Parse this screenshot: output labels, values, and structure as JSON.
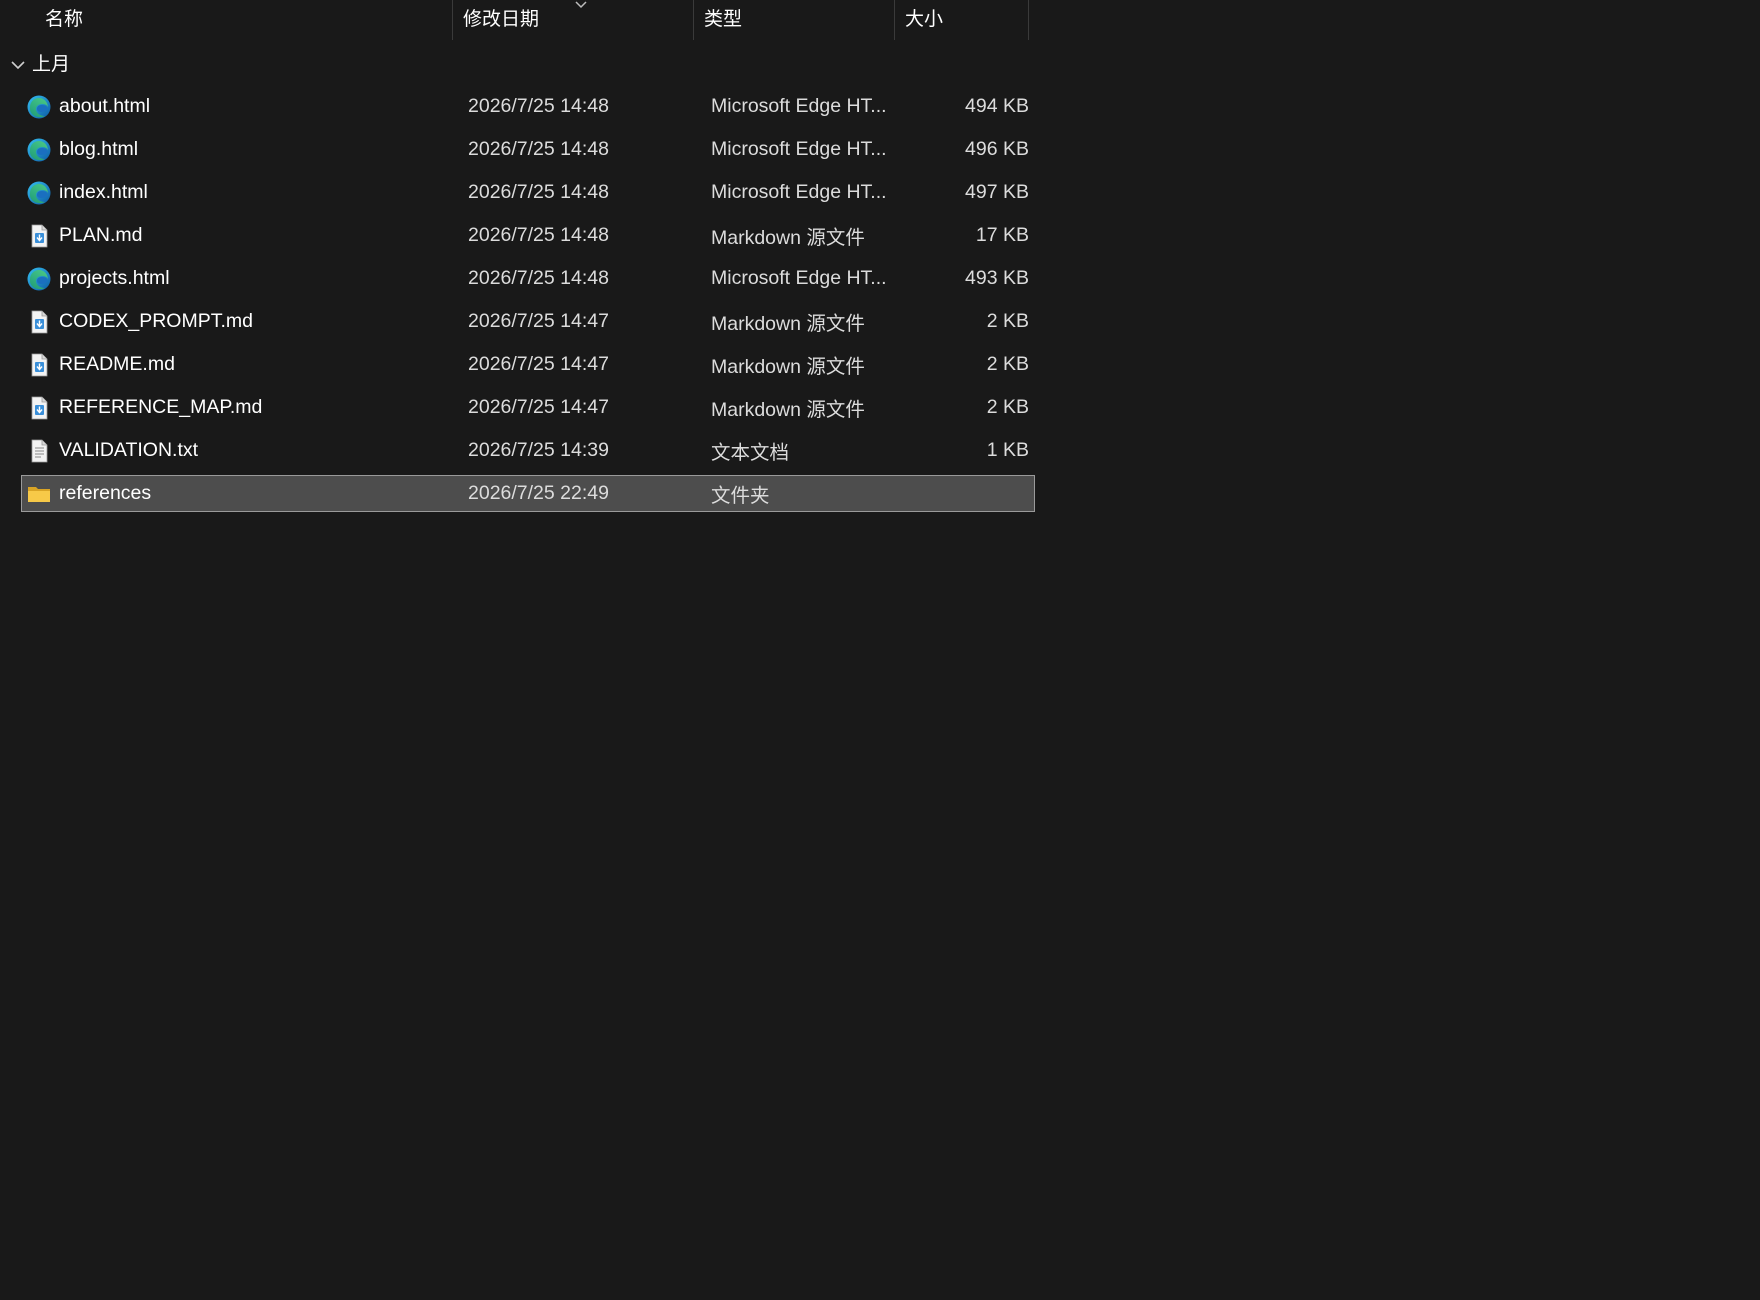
{
  "header": {
    "columns": {
      "name": "名称",
      "modified": "修改日期",
      "type": "类型",
      "size": "大小"
    }
  },
  "group": {
    "label": "上月"
  },
  "files": [
    {
      "name": "about.html",
      "modified": "2026/7/25 14:48",
      "type": "Microsoft Edge HT...",
      "size": "494 KB",
      "icon": "edge-icon"
    },
    {
      "name": "blog.html",
      "modified": "2026/7/25 14:48",
      "type": "Microsoft Edge HT...",
      "size": "496 KB",
      "icon": "edge-icon"
    },
    {
      "name": "index.html",
      "modified": "2026/7/25 14:48",
      "type": "Microsoft Edge HT...",
      "size": "497 KB",
      "icon": "edge-icon"
    },
    {
      "name": "PLAN.md",
      "modified": "2026/7/25 14:48",
      "type": "Markdown 源文件",
      "size": "17 KB",
      "icon": "markdown-file-icon"
    },
    {
      "name": "projects.html",
      "modified": "2026/7/25 14:48",
      "type": "Microsoft Edge HT...",
      "size": "493 KB",
      "icon": "edge-icon"
    },
    {
      "name": "CODEX_PROMPT.md",
      "modified": "2026/7/25 14:47",
      "type": "Markdown 源文件",
      "size": "2 KB",
      "icon": "markdown-file-icon"
    },
    {
      "name": "README.md",
      "modified": "2026/7/25 14:47",
      "type": "Markdown 源文件",
      "size": "2 KB",
      "icon": "markdown-file-icon"
    },
    {
      "name": "REFERENCE_MAP.md",
      "modified": "2026/7/25 14:47",
      "type": "Markdown 源文件",
      "size": "2 KB",
      "icon": "markdown-file-icon"
    },
    {
      "name": "VALIDATION.txt",
      "modified": "2026/7/25 14:39",
      "type": "文本文档",
      "size": "1 KB",
      "icon": "text-file-icon"
    },
    {
      "name": "references",
      "modified": "2026/7/25 22:49",
      "type": "文件夹",
      "size": "",
      "icon": "folder-icon",
      "selected": true
    }
  ],
  "colors": {
    "background": "#191919",
    "selection_fill": "#4d4d4d",
    "selection_border": "#9a9a9a",
    "folder_yellow": "#f7c948"
  }
}
